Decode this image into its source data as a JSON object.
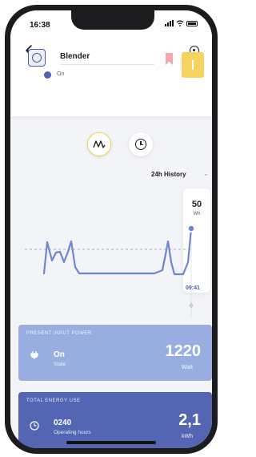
{
  "status_bar": {
    "time": "16:38"
  },
  "device": {
    "name": "Blender",
    "status": "On"
  },
  "history": {
    "label": "24h History"
  },
  "tooltip": {
    "value": "50",
    "unit": "Wh",
    "time": "09:41"
  },
  "present_power": {
    "title": "PRESENT INPUT POWER",
    "state_value": "On",
    "state_label": "State",
    "value": "1220",
    "unit": "Watt"
  },
  "total_energy": {
    "title": "TOTAL ENERGY USE",
    "hours_value": "0240",
    "hours_label": "Operating hours",
    "value": "2,1",
    "unit": "kWh"
  },
  "colors": {
    "accent_yellow": "#f6d35e",
    "power_card": "#98aee0",
    "energy_card": "#5466b3",
    "chart_line": "#6f86cf"
  }
}
